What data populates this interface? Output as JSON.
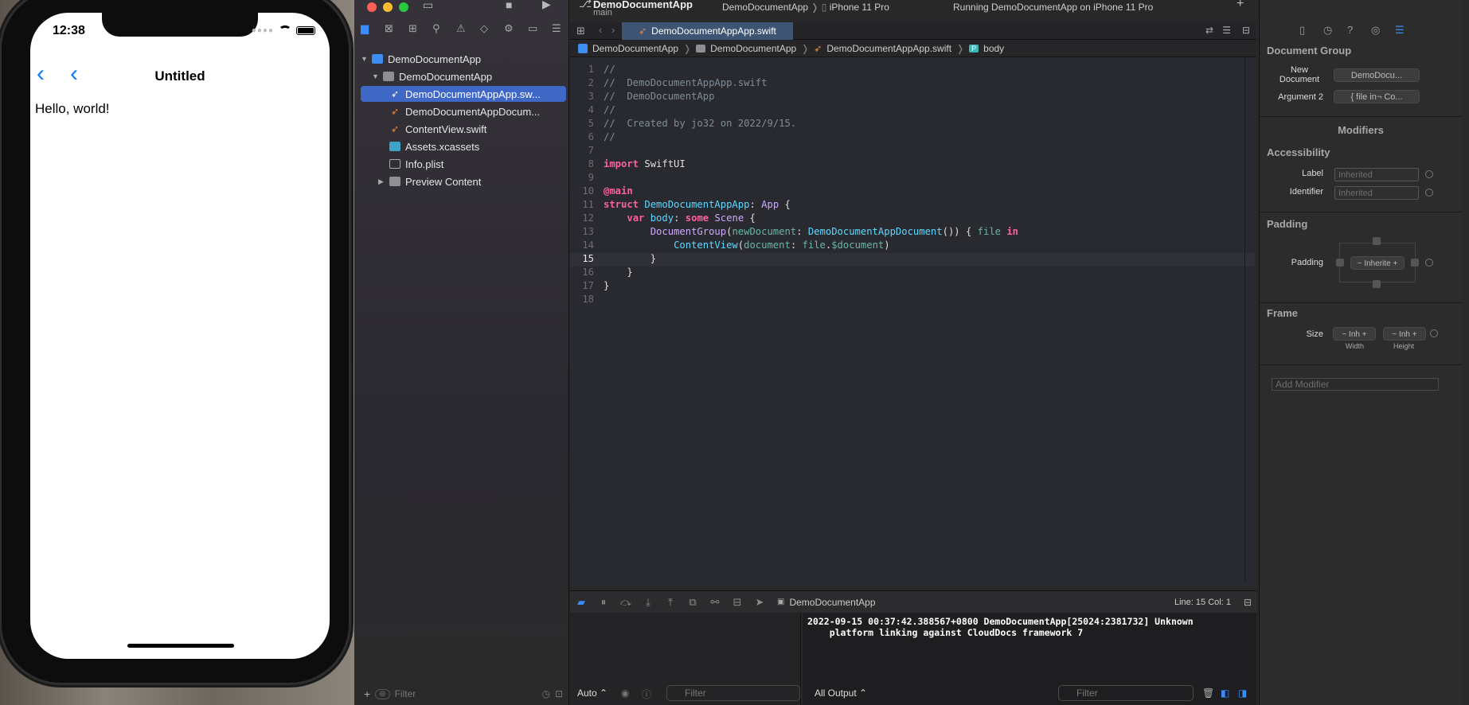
{
  "simulator": {
    "time": "12:38",
    "nav_title": "Untitled",
    "content": "Hello, world!"
  },
  "toolbar": {
    "scheme": "DemoDocumentApp",
    "branch": "main",
    "destination_app": "DemoDocumentApp",
    "destination_device": "iPhone 11 Pro",
    "status": "Running DemoDocumentApp on iPhone 11 Pro"
  },
  "navigator": {
    "items": [
      {
        "label": "DemoDocumentApp",
        "kind": "project"
      },
      {
        "label": "DemoDocumentApp",
        "kind": "folder"
      },
      {
        "label": "DemoDocumentAppApp.sw...",
        "kind": "swift",
        "selected": true
      },
      {
        "label": "DemoDocumentAppDocum...",
        "kind": "swift"
      },
      {
        "label": "ContentView.swift",
        "kind": "swift"
      },
      {
        "label": "Assets.xcassets",
        "kind": "assets"
      },
      {
        "label": "Info.plist",
        "kind": "plist"
      },
      {
        "label": "Preview Content",
        "kind": "folder"
      }
    ],
    "filter_placeholder": "Filter"
  },
  "editor": {
    "tab": "DemoDocumentAppApp.swift",
    "breadcrumbs": [
      "DemoDocumentApp",
      "DemoDocumentApp",
      "DemoDocumentAppApp.swift",
      "body"
    ],
    "current_line": 15
  },
  "debug": {
    "target": "DemoDocumentApp",
    "position": "Line: 15  Col: 1",
    "console_text": "2022-09-15 00:37:42.388567+0800 DemoDocumentApp[25024:2381732] Unknown\n    platform linking against CloudDocs framework 7",
    "auto_label": "Auto",
    "filter_placeholder": "Filter",
    "output_label": "All Output",
    "console_filter_placeholder": "Filter"
  },
  "inspector": {
    "section_document_group": "Document Group",
    "new_document_label": "New Document",
    "new_document_value": "DemoDocu...",
    "argument2_label": "Argument 2",
    "argument2_value": "{ file in¬ Co...",
    "modifiers_title": "Modifiers",
    "accessibility_title": "Accessibility",
    "label_label": "Label",
    "label_placeholder": "Inherited",
    "identifier_label": "Identifier",
    "identifier_placeholder": "Inherited",
    "padding_title": "Padding",
    "padding_label": "Padding",
    "padding_value": "Inherite",
    "frame_title": "Frame",
    "size_label": "Size",
    "width_value": "Inh",
    "width_label": "Width",
    "height_value": "Inh",
    "height_label": "Height",
    "add_modifier_placeholder": "Add Modifier"
  },
  "colors": {
    "accent": "#3f68c6",
    "keyword": "#fc5fa3",
    "type": "#5dd8ff",
    "comment": "#7f8c98",
    "ios_blue": "#0a7cff"
  }
}
